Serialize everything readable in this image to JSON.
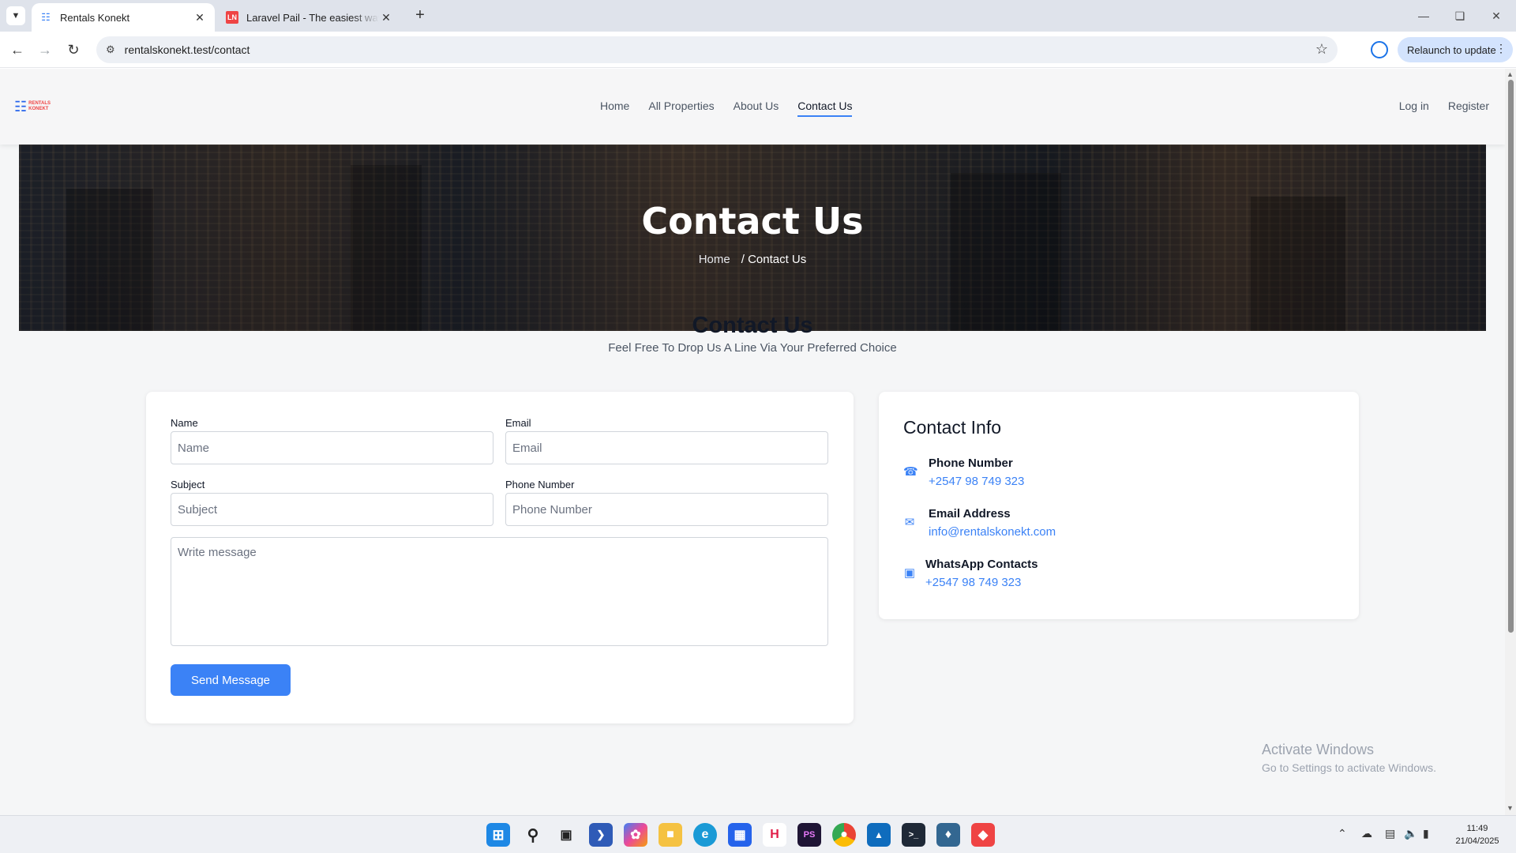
{
  "browser": {
    "tabs": [
      {
        "title": "Rentals Konekt",
        "active": true
      },
      {
        "title": "Laravel Pail - The easiest way to",
        "active": false
      }
    ],
    "url": "rentalskonekt.test/contact",
    "relaunch_label": "Relaunch to update"
  },
  "site": {
    "logo_text": "RENTALS KONEKT",
    "nav": [
      "Home",
      "All Properties",
      "About Us",
      "Contact Us"
    ],
    "auth": {
      "login": "Log in",
      "register": "Register"
    }
  },
  "hero": {
    "title": "Contact Us",
    "breadcrumb_home": "Home",
    "breadcrumb_current": "/ Contact Us"
  },
  "section": {
    "title": "Contact Us",
    "subtitle": "Feel Free To Drop Us A Line Via Your Preferred Choice"
  },
  "form": {
    "name_label": "Name",
    "name_placeholder": "Name",
    "email_label": "Email",
    "email_placeholder": "Email",
    "subject_label": "Subject",
    "subject_placeholder": "Subject",
    "phone_label": "Phone Number",
    "phone_placeholder": "Phone Number",
    "message_placeholder": "Write message",
    "submit_label": "Send Message"
  },
  "contact_info": {
    "title": "Contact Info",
    "items": [
      {
        "label": "Phone Number",
        "value": "+2547 98 749 323",
        "icon": "phone-icon"
      },
      {
        "label": "Email Address",
        "value": "info@rentalskonekt.com",
        "icon": "envelope-icon"
      },
      {
        "label": "WhatsApp Contacts",
        "value": "+2547 98 749 323",
        "icon": "whatsapp-icon"
      }
    ]
  },
  "watermark": {
    "line1": "Activate Windows",
    "line2": "Go to Settings to activate Windows."
  },
  "taskbar": {
    "time": "11:49",
    "date": "21/04/2025"
  },
  "colors": {
    "accent": "#3b82f6",
    "page_bg": "#f5f6f7"
  }
}
